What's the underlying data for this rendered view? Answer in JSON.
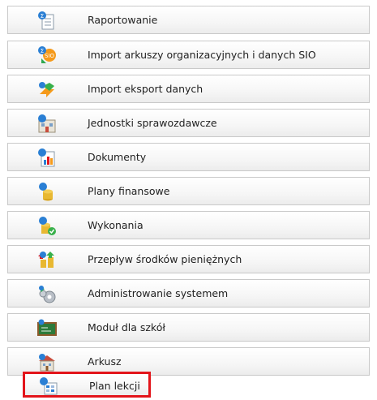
{
  "menu": {
    "items": [
      {
        "label": "Raportowanie",
        "icon": "report-document-icon"
      },
      {
        "label": "Import arkuszy organizacyjnych i danych SIO",
        "icon": "sio-import-icon"
      },
      {
        "label": "Import eksport danych",
        "icon": "import-export-arrows-icon"
      },
      {
        "label": "Jednostki sprawozdawcze",
        "icon": "building-units-icon"
      },
      {
        "label": "Dokumenty",
        "icon": "documents-chart-icon"
      },
      {
        "label": "Plany finansowe",
        "icon": "coins-stack-icon"
      },
      {
        "label": "Wykonania",
        "icon": "coins-check-icon"
      },
      {
        "label": "Przepływ środków pieniężnych",
        "icon": "cash-flow-icon"
      },
      {
        "label": "Administrowanie systemem",
        "icon": "gears-admin-icon"
      },
      {
        "label": "Moduł dla szkół",
        "icon": "chalkboard-icon"
      },
      {
        "label": "Arkusz",
        "icon": "school-building-icon"
      },
      {
        "label": "Plan lekcji",
        "icon": "timetable-icon"
      }
    ]
  },
  "colors": {
    "highlight_border": "#e3141a",
    "item_border": "#c9c9c9",
    "sigma_blue": "#2a7fd4"
  }
}
